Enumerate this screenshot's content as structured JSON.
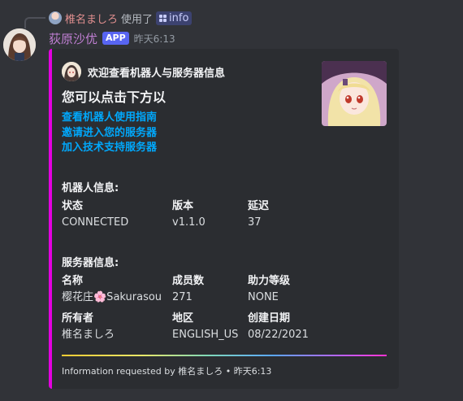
{
  "reply": {
    "user": "椎名ましろ",
    "used_text": "使用了",
    "command": "info"
  },
  "message": {
    "author": "荻原沙优",
    "badge": "APP",
    "timestamp": "昨天6:13"
  },
  "embed": {
    "accent_color": "#e300e0",
    "author": "欢迎查看机器人与服务器信息",
    "title": "您可以点击下方以",
    "links": [
      "查看机器人使用指南",
      "邀请进入您的服务器",
      "加入技术支持服务器"
    ],
    "bot_section": {
      "title": "机器人信息:",
      "fields": [
        {
          "name": "状态",
          "value": "CONNECTED"
        },
        {
          "name": "版本",
          "value": "v1.1.0"
        },
        {
          "name": "延迟",
          "value": "37"
        }
      ]
    },
    "server_section": {
      "title": "服务器信息:",
      "fields": [
        {
          "name": "名称",
          "value": "樱花庄🌸Sakurasou"
        },
        {
          "name": "成员数",
          "value": "271"
        },
        {
          "name": "助力等级",
          "value": "NONE"
        },
        {
          "name": "所有者",
          "value": "椎名ましろ"
        },
        {
          "name": "地区",
          "value": "ENGLISH_US"
        },
        {
          "name": "创建日期",
          "value": "08/22/2021"
        }
      ]
    },
    "footer": "Information requested by 椎名ましろ • 昨天6:13"
  }
}
